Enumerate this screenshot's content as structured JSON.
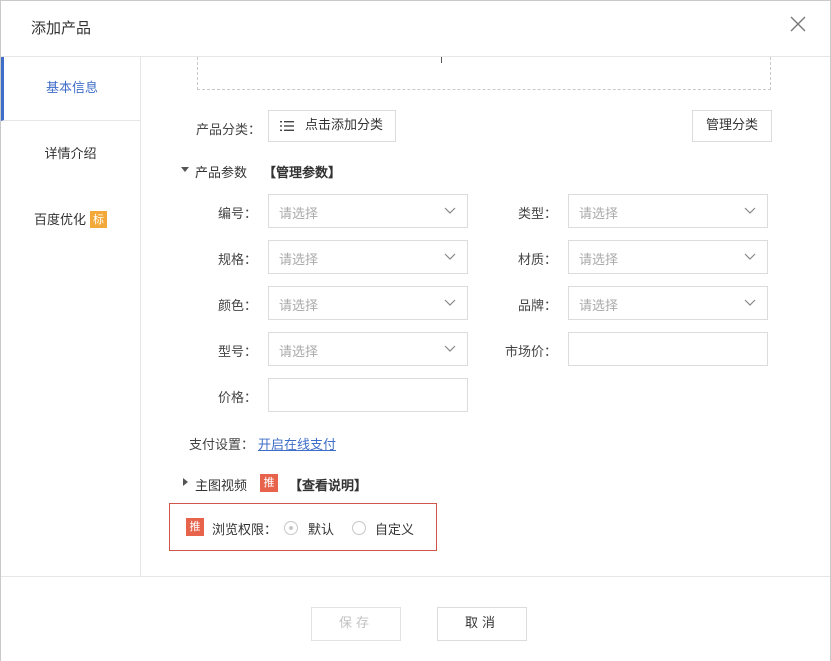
{
  "dialog": {
    "title": "添加产品"
  },
  "sidebar": {
    "items": [
      {
        "label": "基本信息"
      },
      {
        "label": "详情介绍"
      },
      {
        "label": "百度优化",
        "badge": "标"
      }
    ]
  },
  "category": {
    "label": "产品分类：",
    "add_button": "点击添加分类",
    "manage_button": "管理分类"
  },
  "params": {
    "title": "产品参数",
    "manage_link": "【管理参数】",
    "fields": {
      "bianhao": {
        "label": "编号：",
        "placeholder": "请选择"
      },
      "leixing": {
        "label": "类型：",
        "placeholder": "请选择"
      },
      "guige": {
        "label": "规格：",
        "placeholder": "请选择"
      },
      "caizhi": {
        "label": "材质：",
        "placeholder": "请选择"
      },
      "yanse": {
        "label": "颜色：",
        "placeholder": "请选择"
      },
      "pinpai": {
        "label": "品牌：",
        "placeholder": "请选择"
      },
      "xinghao": {
        "label": "型号：",
        "placeholder": "请选择"
      },
      "shichangjia": {
        "label": "市场价：",
        "value": ""
      },
      "jiage": {
        "label": "价格：",
        "value": ""
      }
    }
  },
  "payment": {
    "label": "支付设置：",
    "link": "开启在线支付"
  },
  "video": {
    "title": "主图视频",
    "badge": "推",
    "help_link": "【查看说明】"
  },
  "permission": {
    "badge": "推",
    "label": "浏览权限：",
    "options": [
      {
        "label": "默认",
        "checked": true
      },
      {
        "label": "自定义",
        "checked": false
      }
    ]
  },
  "footer": {
    "save": "保存",
    "cancel": "取消"
  }
}
